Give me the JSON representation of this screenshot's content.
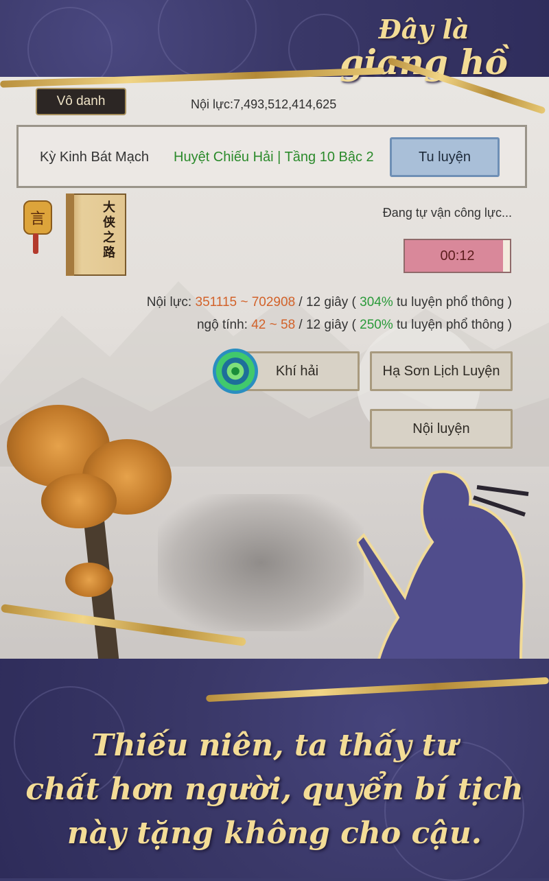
{
  "banner": {
    "title_line1": "Đây là",
    "title_line2": "giang hồ"
  },
  "header": {
    "name_button": "Vô danh",
    "power_text": "Nội lực:7,493,512,414,625"
  },
  "meridian": {
    "name": "Kỳ Kinh Bát Mạch",
    "point": "Huyệt Chiếu Hải | Tầng 10 Bậc 2",
    "train_button": "Tu luyện"
  },
  "lantern": {
    "glyph": "言"
  },
  "book": {
    "title": "大侠之路"
  },
  "cultivation": {
    "status": "Đang tự vận công lực...",
    "timer": "00:12"
  },
  "stats": {
    "neiluc": {
      "label": "Nội lực:",
      "range": "351115 ~ 702908",
      "per": "/ 12 giây (",
      "percent": "304%",
      "suffix": "tu luyện phổ thông )"
    },
    "ngotinh": {
      "label": "ngộ tính:",
      "range": "42 ~ 58",
      "per": "/ 12 giây (",
      "percent": "250%",
      "suffix": "tu luyện phổ thông )"
    }
  },
  "buttons": {
    "khi_hai": "Khí hải",
    "ha_son": "Hạ Sơn Lịch Luyện",
    "noi_luyen": "Nội luyện"
  },
  "caption": {
    "line1": "Thiếu niên, ta thấy tư",
    "line2": "chất hơn người, quyển bí tịch",
    "line3": "này tặng không cho cậu."
  },
  "colors": {
    "banner_bg": "#3a3868",
    "gold": "#f3dc96",
    "stat_orange": "#d2622a",
    "stat_green": "#2a9a3a",
    "meridian_green": "#2b8a2b"
  }
}
